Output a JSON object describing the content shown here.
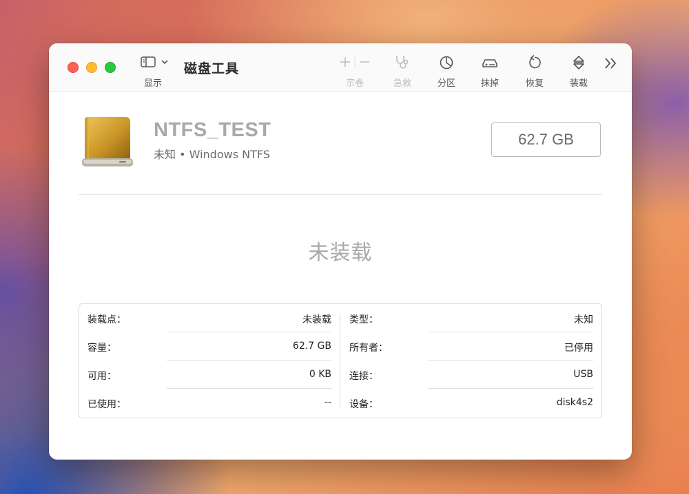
{
  "window": {
    "title": "磁盘工具"
  },
  "toolbar": {
    "view_label": "显示",
    "volume_label": "宗卷",
    "firstaid_label": "急救",
    "partition_label": "分区",
    "erase_label": "抹掉",
    "restore_label": "恢复",
    "mount_label": "装载",
    "volume_disabled": true,
    "firstaid_disabled": true
  },
  "volume": {
    "name": "NTFS_TEST",
    "subtitle": "未知 • Windows NTFS",
    "capacity": "62.7 GB",
    "status": "未装载"
  },
  "info": {
    "left": [
      {
        "key": "装载点：",
        "value": "未装载"
      },
      {
        "key": "容量：",
        "value": "62.7 GB"
      },
      {
        "key": "可用：",
        "value": "0 KB"
      },
      {
        "key": "已使用：",
        "value": "--"
      }
    ],
    "right": [
      {
        "key": "类型：",
        "value": "未知"
      },
      {
        "key": "所有者：",
        "value": "已停用"
      },
      {
        "key": "连接：",
        "value": "USB"
      },
      {
        "key": "设备：",
        "value": "disk4s2"
      }
    ]
  },
  "colors": {
    "close": "#fe5f57",
    "minimize": "#febc2e",
    "zoom": "#28c840",
    "drive_gold": "#c89a2a"
  },
  "icons": {
    "view": "sidebar-icon",
    "add": "plus-icon",
    "remove": "minus-icon",
    "firstaid": "stethoscope-icon",
    "partition": "pie-chart-icon",
    "erase": "eraser-car-icon",
    "restore": "restore-arrow-icon",
    "mount": "eject-icon",
    "overflow": "double-chevron-icon",
    "drive": "external-drive-icon"
  }
}
